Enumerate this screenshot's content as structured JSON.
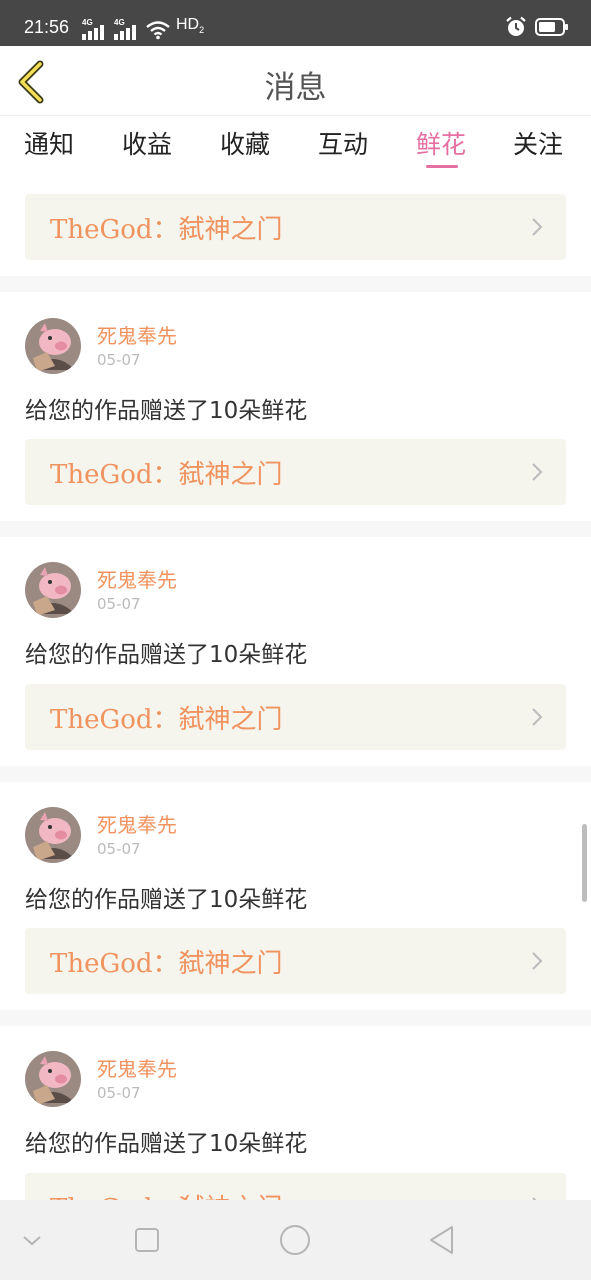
{
  "status_bar": {
    "time": "21:56",
    "signal1_label": "4G",
    "signal2_label": "4G",
    "hd_label": "HD",
    "hd_sub": "2",
    "icons": [
      "signal-icon",
      "signal-icon",
      "wifi-icon",
      "alarm-icon",
      "battery-icon"
    ]
  },
  "header": {
    "title": "消息",
    "back_icon": "chevron-left-icon"
  },
  "tabs": [
    {
      "label": "通知",
      "active": false
    },
    {
      "label": "收益",
      "active": false
    },
    {
      "label": "收藏",
      "active": false
    },
    {
      "label": "互动",
      "active": false
    },
    {
      "label": "鲜花",
      "active": true
    },
    {
      "label": "关注",
      "active": false
    }
  ],
  "top_book_link": {
    "text": "TheGod：弑神之门"
  },
  "messages": [
    {
      "user": "死鬼奉先",
      "date": "05-07",
      "text": "给您的作品赠送了10朵鲜花",
      "book": "TheGod：弑神之门"
    },
    {
      "user": "死鬼奉先",
      "date": "05-07",
      "text": "给您的作品赠送了10朵鲜花",
      "book": "TheGod：弑神之门"
    },
    {
      "user": "死鬼奉先",
      "date": "05-07",
      "text": "给您的作品赠送了10朵鲜花",
      "book": "TheGod：弑神之门"
    },
    {
      "user": "死鬼奉先",
      "date": "05-07",
      "text": "给您的作品赠送了10朵鲜花",
      "book": "TheGod：弑神之门"
    }
  ],
  "colors": {
    "accent_pink": "#e66fa2",
    "book_orange": "#f0935e",
    "card_bg": "#f5f4ed",
    "status_bar": "#474747"
  },
  "nav_icons": [
    "collapse-icon",
    "recent-apps-icon",
    "home-icon",
    "back-icon"
  ]
}
